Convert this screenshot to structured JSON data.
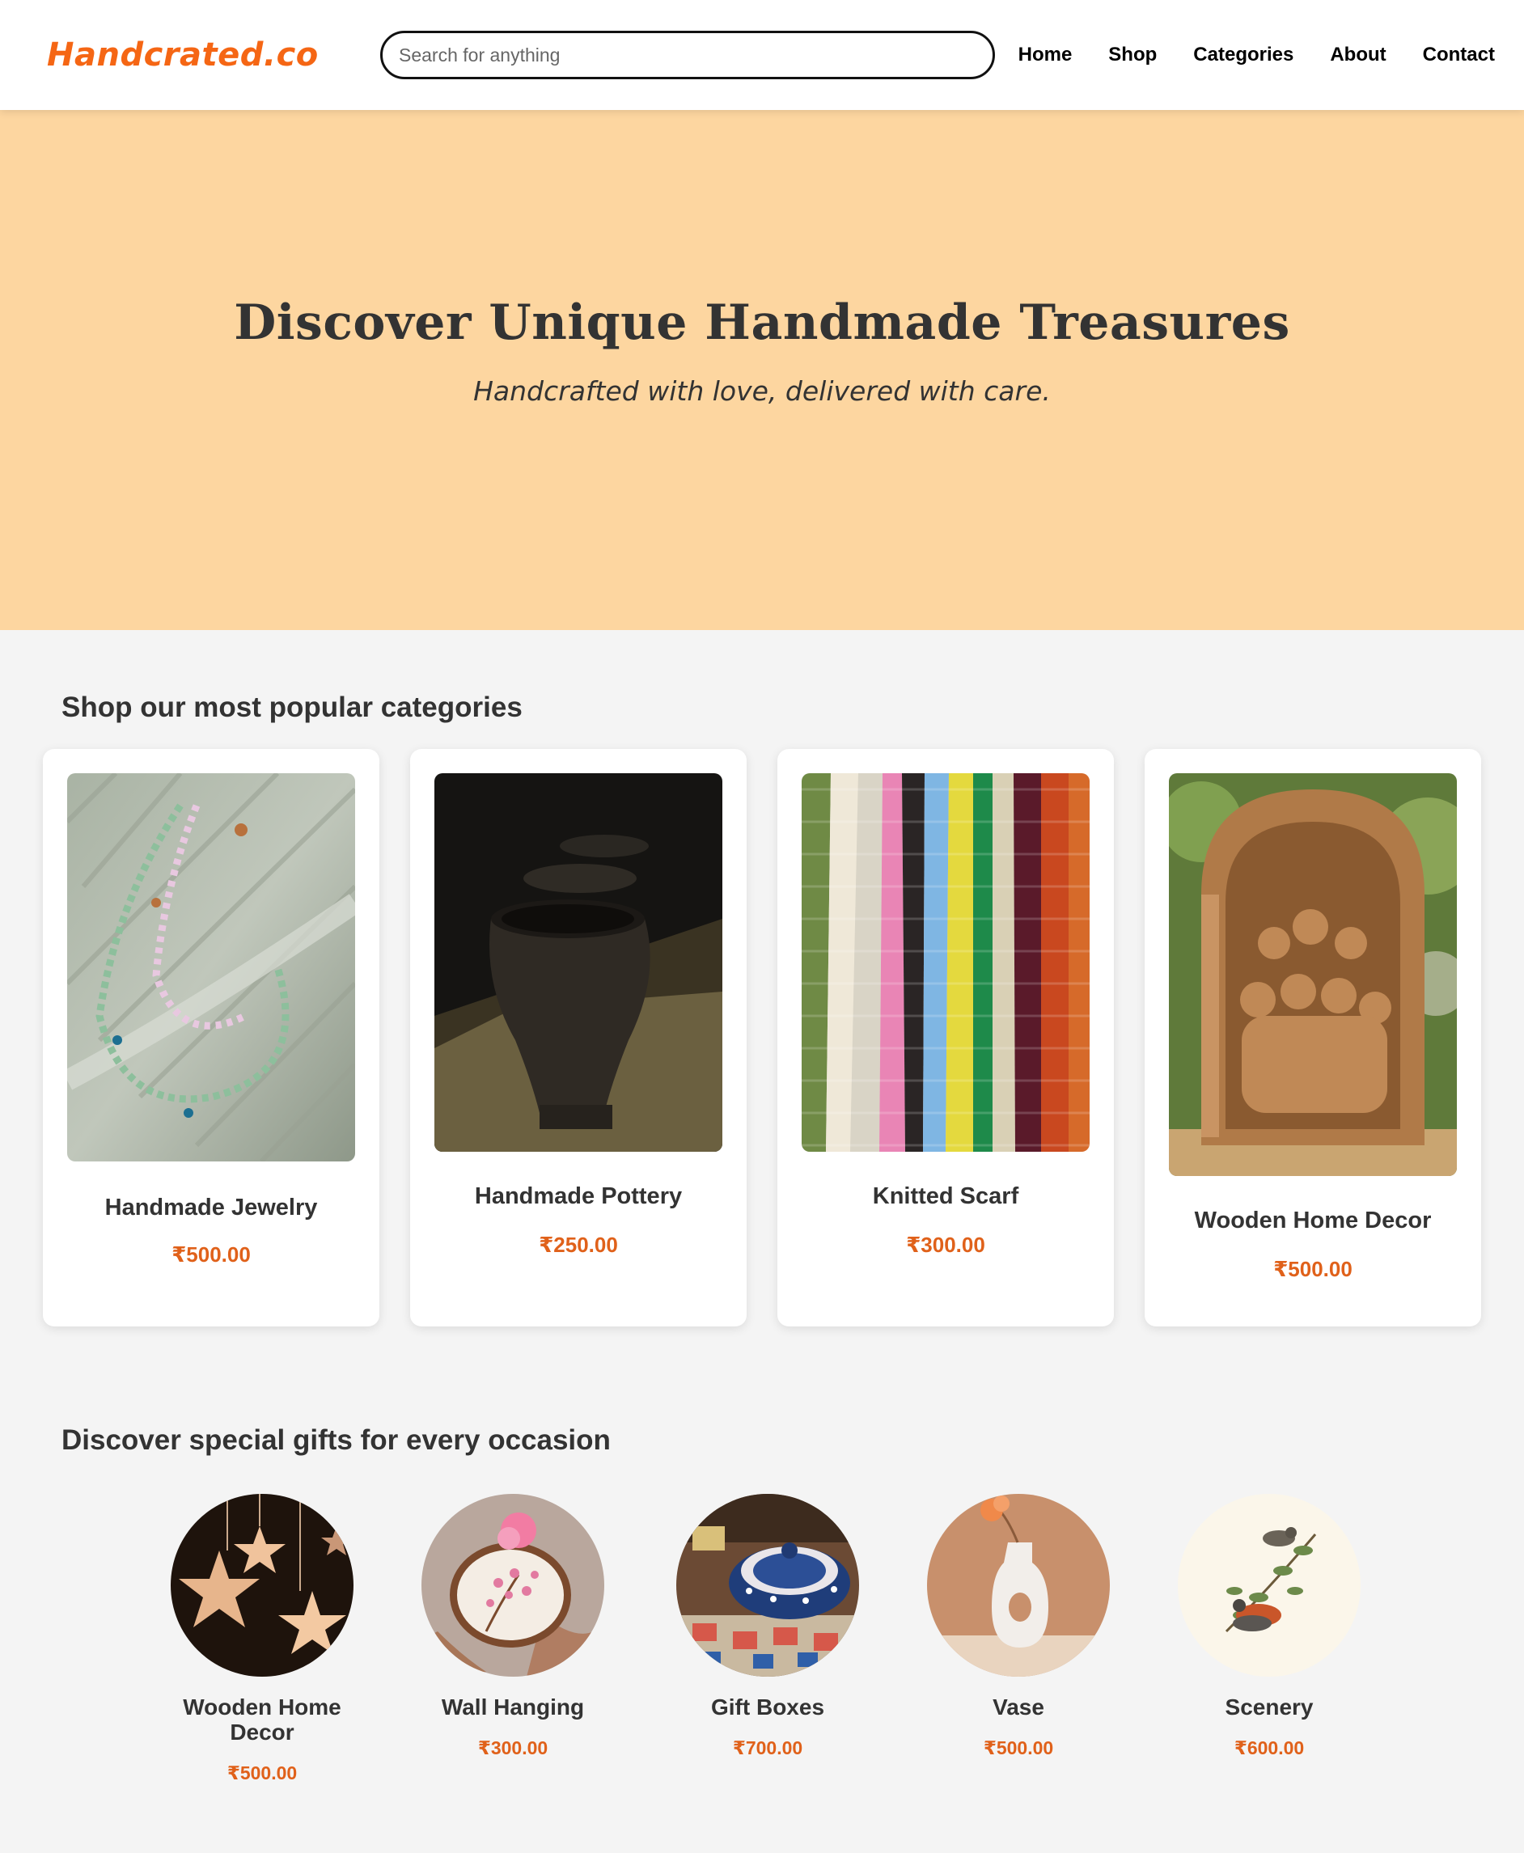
{
  "header": {
    "logo": "Handcrated.co",
    "search_placeholder": "Search for anything",
    "nav": [
      "Home",
      "Shop",
      "Categories",
      "About",
      "Contact"
    ]
  },
  "hero": {
    "title": "Discover Unique Handmade Treasures",
    "subtitle": "Handcrafted with love, delivered with care."
  },
  "categories": {
    "title": "Shop our most popular categories",
    "items": [
      {
        "name": "Handmade Jewelry",
        "price": "₹500.00",
        "image": "beaded-necklace-photo"
      },
      {
        "name": "Handmade Pottery",
        "price": "₹250.00",
        "image": "clay-pot-photo"
      },
      {
        "name": "Knitted Scarf",
        "price": "₹300.00",
        "image": "striped-knit-photo"
      },
      {
        "name": "Wooden Home Decor",
        "price": "₹500.00",
        "image": "wood-carving-photo"
      }
    ]
  },
  "gifts": {
    "title": "Discover special gifts for every occasion",
    "items": [
      {
        "name": "Wooden Home Decor",
        "price": "₹500.00",
        "image": "hanging-stars-photo"
      },
      {
        "name": "Wall Hanging",
        "price": "₹300.00",
        "image": "embroidery-hoop-photo"
      },
      {
        "name": "Gift Boxes",
        "price": "₹700.00",
        "image": "ceramic-boxes-photo"
      },
      {
        "name": "Vase",
        "price": "₹500.00",
        "image": "white-vase-photo"
      },
      {
        "name": "Scenery",
        "price": "₹600.00",
        "image": "bird-illustration-photo"
      }
    ]
  },
  "colors": {
    "accent": "#f56614",
    "price": "#e0611a",
    "hero_bg": "#fdd6a0",
    "page_bg": "#f4f4f4"
  }
}
